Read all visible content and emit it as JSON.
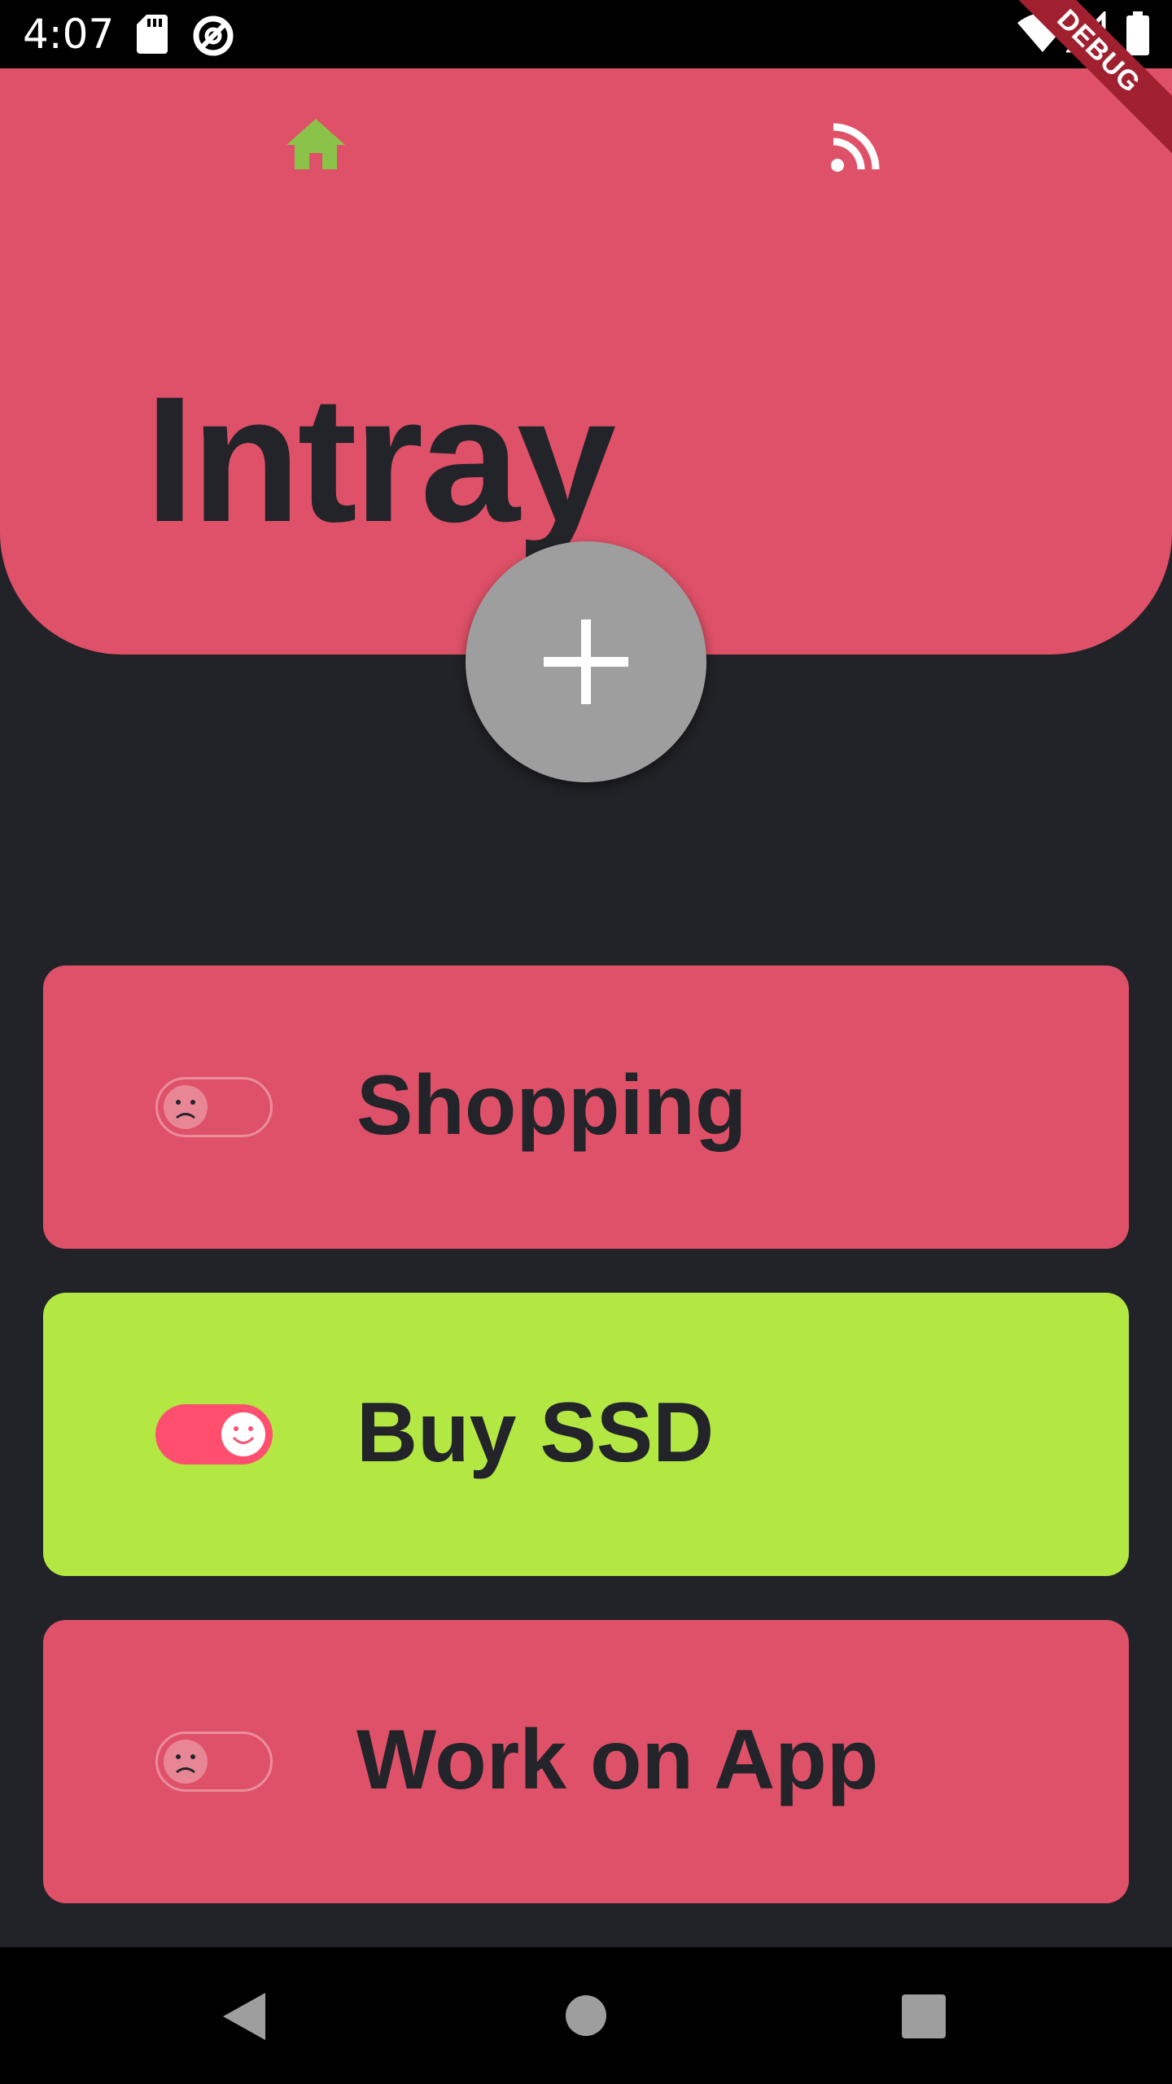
{
  "status_bar": {
    "time": "4:07",
    "left_icons": [
      "sd-card-icon",
      "data-saver-icon"
    ],
    "right_icons": [
      "wifi-icon",
      "cell-signal-icon",
      "battery-icon"
    ],
    "debug_label": "DEBUG"
  },
  "header": {
    "nav_icons": [
      "home-icon",
      "rss-feed-icon"
    ],
    "active_nav": "home-icon",
    "title": "Intray",
    "add_button_icon": "plus-icon"
  },
  "tasks": [
    {
      "label": "Shopping",
      "done": false,
      "toggle_icon": "sad-face-icon",
      "card_color": "#df5168"
    },
    {
      "label": "Buy SSD",
      "done": true,
      "toggle_icon": "smile-face-icon",
      "card_color": "#b3e843"
    },
    {
      "label": "Work on App",
      "done": false,
      "toggle_icon": "sad-face-icon",
      "card_color": "#df5168"
    }
  ],
  "navigation_bar": {
    "buttons": [
      "back-icon",
      "home-circle-icon",
      "recents-icon"
    ]
  },
  "colors": {
    "background": "#222328",
    "header": "#df5168",
    "active_nav": "#8bc34a",
    "fab": "#9e9e9e",
    "task_open": "#df5168",
    "task_done": "#b3e843",
    "toggle_on": "#ff4f6f"
  }
}
